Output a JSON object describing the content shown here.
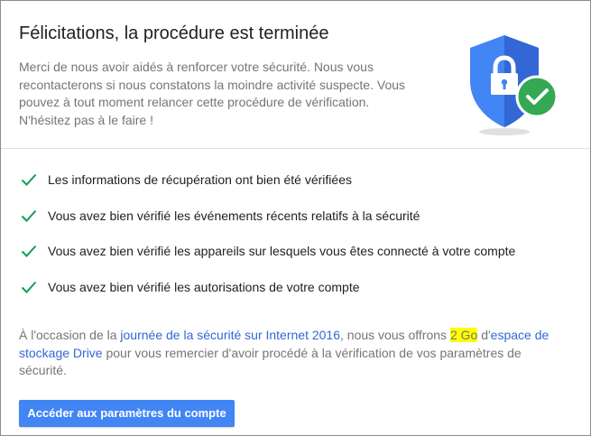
{
  "header": {
    "title": "Félicitations, la procédure est terminée",
    "intro": "Merci de nous avoir aidés à renforcer votre sécurité. Nous vous recontacterons si nous constatons la moindre activité suspecte. Vous pouvez à tout moment relancer cette procédure de vérification. N'hésitez pas à le faire !"
  },
  "checks": [
    "Les informations de récupération ont bien été vérifiées",
    "Vous avez bien vérifié les événements récents relatifs à la sécurité",
    "Vous avez bien vérifié les appareils sur lesquels vous êtes connecté à votre compte",
    "Vous avez bien vérifié les autorisations de votre compte"
  ],
  "offer": {
    "part1": "À l'occasion de la ",
    "link1": "journée de la sécurité sur Internet 2016",
    "part2": ", nous vous offrons ",
    "highlight": "2 Go",
    "part3": " d'",
    "link2": "espace de stockage Drive",
    "part4": " pour vous remercier d'avoir procédé à la vérification de vos paramètres de sécurité."
  },
  "cta": {
    "label": "Accéder aux paramètres du compte"
  },
  "icons": {
    "shield": "shield-lock-icon",
    "check": "check-icon"
  },
  "colors": {
    "accent": "#4285f4",
    "link": "#3367d6",
    "check": "#0f9d58",
    "shield": "#4285f4",
    "shield_dark": "#3367d6",
    "badge": "#34a853",
    "highlight": "#ffff00"
  }
}
